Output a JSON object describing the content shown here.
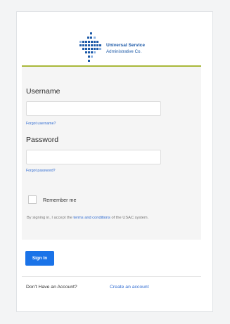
{
  "brand": {
    "name_line1": "Universal Service",
    "name_line2": "Administrative Co.",
    "logo_icon": "usac-logo-icon",
    "color": "#1d5aa8"
  },
  "form": {
    "accent_color": "#a9b83a",
    "username_label": "Username",
    "username_value": "",
    "forgot_username": "Forgot username?",
    "password_label": "Password",
    "password_value": "",
    "forgot_password": "Forgot password?",
    "remember_label": "Remember me",
    "remember_checked": false,
    "consent_prefix": "By signing in, I accept the ",
    "consent_link": "terms and conditions",
    "consent_suffix": " of the USAC system."
  },
  "actions": {
    "sign_in_label": "Sign In",
    "button_color": "#1a73e8"
  },
  "footer": {
    "prompt": "Don't Have an Account?",
    "create_link": "Create an account",
    "link_color": "#2f6bd1"
  }
}
